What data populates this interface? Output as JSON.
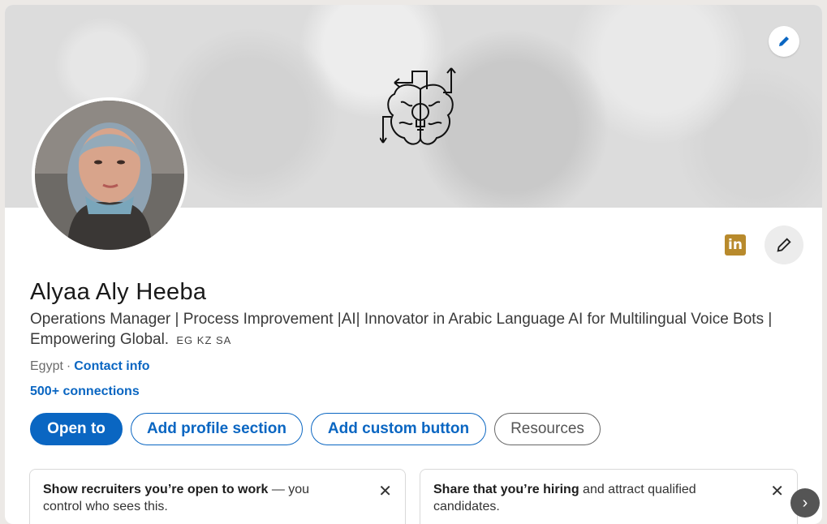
{
  "profile": {
    "name": "Alyaa Aly Heeba",
    "headline": "Operations Manager | Process Improvement |AI| Innovator in Arabic Language AI for Multilingual Voice Bots | Empowering Global.",
    "flags": "EG KZ SA",
    "location": "Egypt",
    "separator": "·",
    "contact_label": "Contact info",
    "connections": "500+ connections",
    "linkedin_badge": "in"
  },
  "actions": {
    "open_to": "Open to",
    "add_profile_section": "Add profile section",
    "add_custom_button": "Add custom button",
    "resources": "Resources"
  },
  "promos": [
    {
      "bold": "Show recruiters you’re open to work",
      "rest": " — you control who sees this.",
      "close": "✕"
    },
    {
      "bold": "Share that you’re hiring",
      "rest": " and attract qualified candidates.",
      "close": "✕"
    }
  ],
  "nav": {
    "next_arrow": "›"
  },
  "colors": {
    "accent": "#0a66c2",
    "badge": "#b88a2c"
  },
  "icons": [
    "pencil-icon",
    "brain-lightbulb-icon",
    "linkedin-icon",
    "close-icon",
    "chevron-right-icon"
  ]
}
